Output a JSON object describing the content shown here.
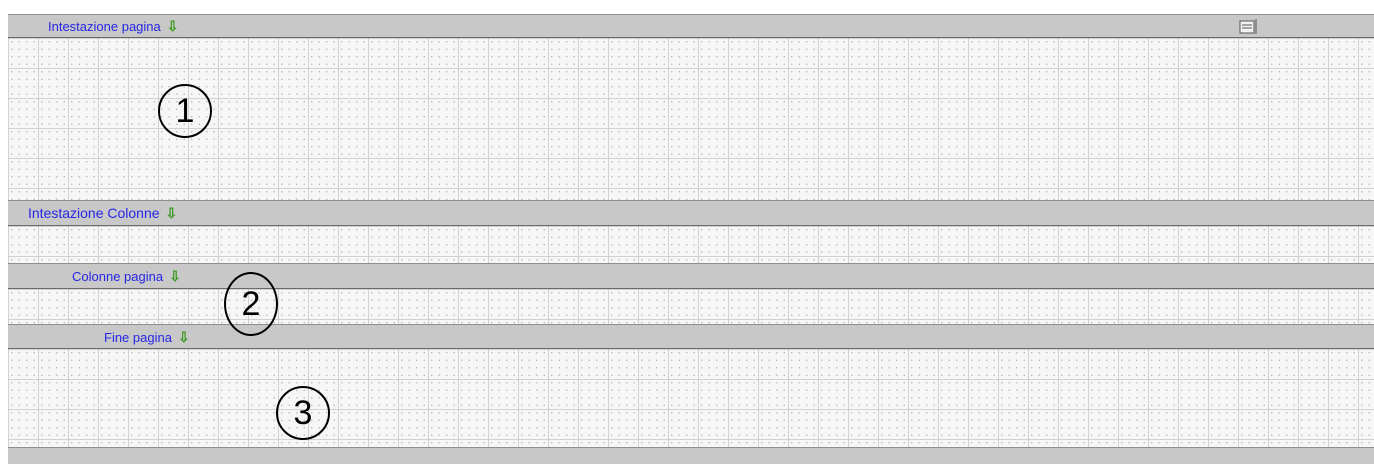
{
  "bands": {
    "page_header": {
      "label": "Intestazione pagina",
      "arrow": "⇩"
    },
    "column_header": {
      "label": "Intestazione Colonne",
      "arrow": "⇩"
    },
    "page_columns": {
      "label": "Colonne pagina",
      "arrow": "⇩"
    },
    "page_footer": {
      "label": "Fine pagina",
      "arrow": "⇩"
    }
  },
  "markers": {
    "one": "1",
    "two": "2",
    "three": "3"
  },
  "icons": {
    "band_arrow": "down-arrow-icon",
    "toolbar": "print-icon"
  },
  "colors": {
    "label": "#2626e6",
    "arrow": "#3a9a22",
    "band": "#c8c8c8"
  }
}
